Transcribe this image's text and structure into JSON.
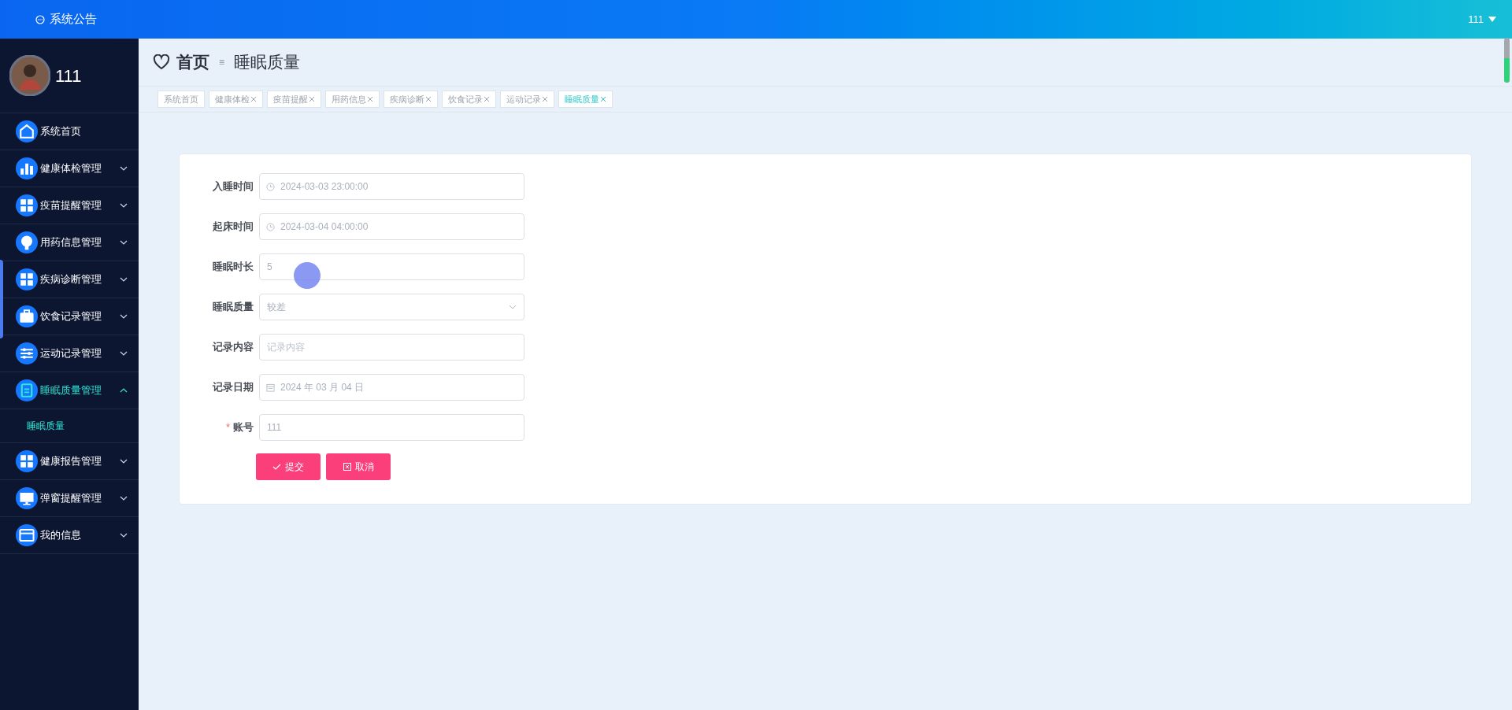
{
  "header": {
    "notice": "系统公告",
    "user": "111"
  },
  "sidebar": {
    "user": "111",
    "items": [
      {
        "label": "系统首页",
        "expandable": false,
        "selected": false
      },
      {
        "label": "健康体检管理",
        "expandable": true,
        "expanded": false,
        "selected": false
      },
      {
        "label": "疫苗提醒管理",
        "expandable": true,
        "expanded": false,
        "selected": false
      },
      {
        "label": "用药信息管理",
        "expandable": true,
        "expanded": false,
        "selected": false
      },
      {
        "label": "疾病诊断管理",
        "expandable": true,
        "expanded": false,
        "selected": false
      },
      {
        "label": "饮食记录管理",
        "expandable": true,
        "expanded": false,
        "selected": false
      },
      {
        "label": "运动记录管理",
        "expandable": true,
        "expanded": false,
        "selected": false
      },
      {
        "label": "睡眠质量管理",
        "expandable": true,
        "expanded": true,
        "selected": true,
        "children": [
          {
            "label": "睡眠质量",
            "selected": true
          }
        ]
      },
      {
        "label": "健康报告管理",
        "expandable": true,
        "expanded": false,
        "selected": false
      },
      {
        "label": "弹窗提醒管理",
        "expandable": true,
        "expanded": false,
        "selected": false
      },
      {
        "label": "我的信息",
        "expandable": true,
        "expanded": false,
        "selected": false
      }
    ]
  },
  "breadcrumb": {
    "home": "首页",
    "separator": "≡",
    "current": "睡眠质量"
  },
  "tabs": [
    {
      "label": "系统首页",
      "closable": false,
      "selected": false
    },
    {
      "label": "健康体检",
      "closable": true,
      "selected": false
    },
    {
      "label": "疫苗提醒",
      "closable": true,
      "selected": false
    },
    {
      "label": "用药信息",
      "closable": true,
      "selected": false
    },
    {
      "label": "疾病诊断",
      "closable": true,
      "selected": false
    },
    {
      "label": "饮食记录",
      "closable": true,
      "selected": false
    },
    {
      "label": "运动记录",
      "closable": true,
      "selected": false
    },
    {
      "label": "睡眠质量",
      "closable": true,
      "selected": true
    }
  ],
  "form": {
    "fields": [
      {
        "label": "入睡时间",
        "kind": "datetime",
        "value": "2024-03-03 23:00:00"
      },
      {
        "label": "起床时间",
        "kind": "datetime",
        "value": "2024-03-04 04:00:00"
      },
      {
        "label": "睡眠时长",
        "kind": "text",
        "value": "5"
      },
      {
        "label": "睡眠质量",
        "kind": "select",
        "value": "较差"
      },
      {
        "label": "记录内容",
        "kind": "text",
        "placeholder": "记录内容"
      },
      {
        "label": "记录日期",
        "kind": "date",
        "value": "2024 年 03 月 04 日"
      },
      {
        "label": "账号",
        "kind": "text",
        "value": "111",
        "required_mark": "*"
      }
    ],
    "buttons": [
      {
        "label": "提交",
        "kind": "submit"
      },
      {
        "label": "取消",
        "kind": "cancel"
      }
    ]
  }
}
